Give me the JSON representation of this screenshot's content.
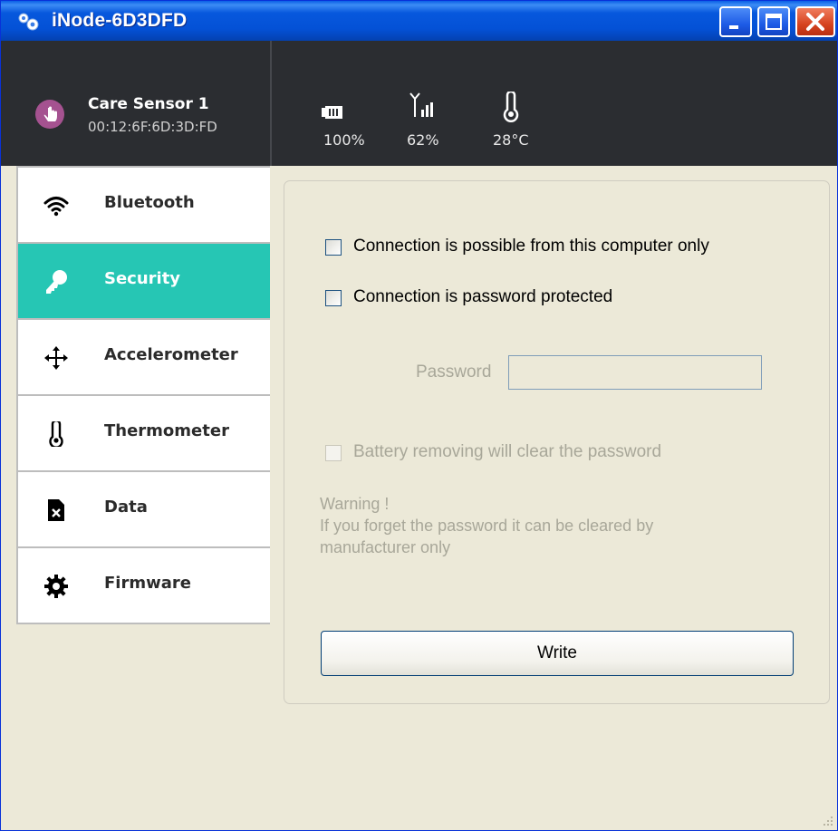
{
  "window": {
    "title": "iNode-6D3DFD"
  },
  "device": {
    "name": "Care Sensor 1",
    "mac": "00:12:6F:6D:3D:FD"
  },
  "stats": {
    "battery": "100%",
    "signal": "62%",
    "temperature": "28°C"
  },
  "sidebar": {
    "items": [
      {
        "label": "Bluetooth",
        "icon": "wifi-icon"
      },
      {
        "label": "Security",
        "icon": "key-icon",
        "active": true
      },
      {
        "label": "Accelerometer",
        "icon": "move-arrows-icon"
      },
      {
        "label": "Thermometer",
        "icon": "thermometer-icon"
      },
      {
        "label": "Data",
        "icon": "file-x-icon"
      },
      {
        "label": "Firmware",
        "icon": "gear-icon"
      }
    ]
  },
  "security": {
    "option_computer_only": "Connection is possible from this computer only",
    "option_password": "Connection is password protected",
    "password_label": "Password",
    "password_value": "",
    "option_battery_clear": "Battery removing will clear the password",
    "warning_line1": "Warning !",
    "warning_line2": "If you forget the password it can be cleared by",
    "warning_line3": "manufacturer only",
    "write_label": "Write"
  },
  "colors": {
    "accent": "#26c6b4",
    "header_bg": "#2b2d31",
    "titlebar": "#0451d6"
  }
}
